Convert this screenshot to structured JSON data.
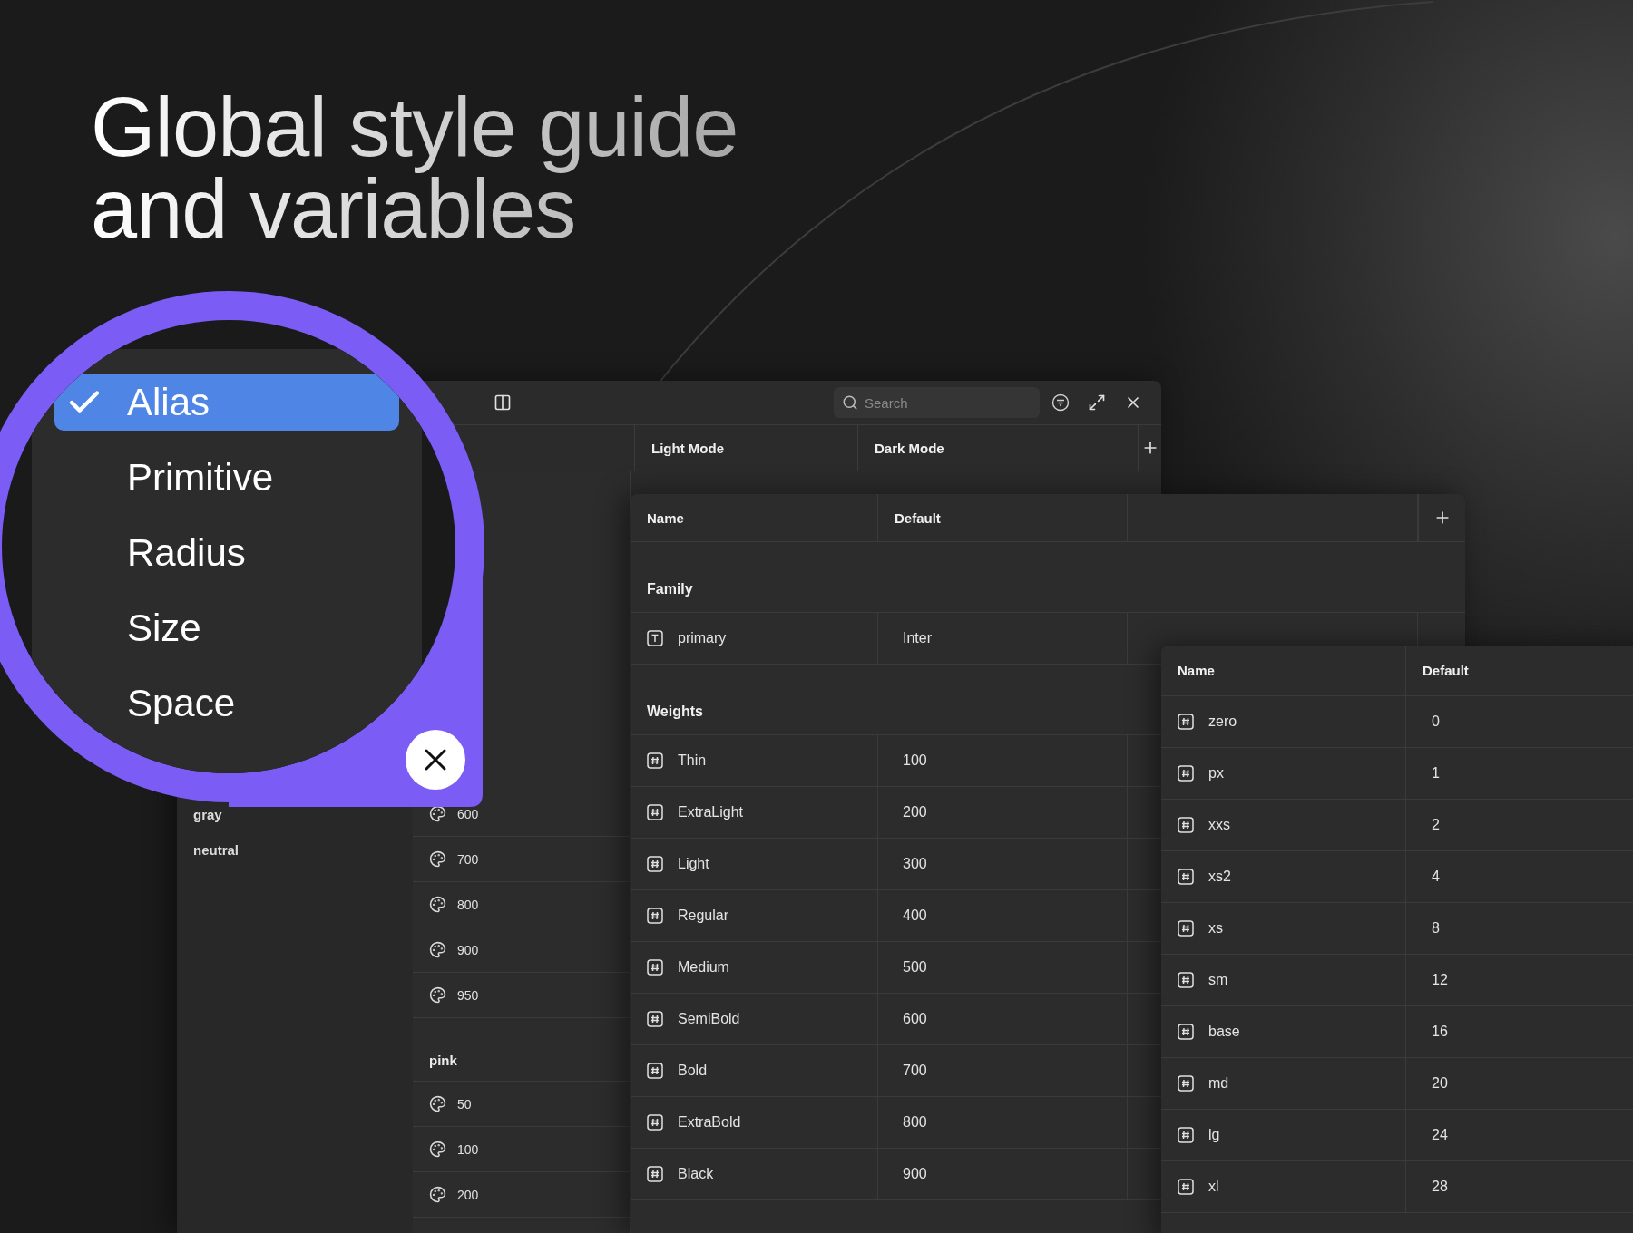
{
  "headline": "Global style guide and variables",
  "type_menu": {
    "items": [
      {
        "label": "Alias",
        "selected": true
      },
      {
        "label": "Primitive",
        "selected": false
      },
      {
        "label": "Radius",
        "selected": false
      },
      {
        "label": "Size",
        "selected": false
      },
      {
        "label": "Space",
        "selected": false
      }
    ]
  },
  "color_window": {
    "search": {
      "placeholder": "Search"
    },
    "modes": [
      "Light Mode",
      "Dark Mode"
    ],
    "groups": [
      "gray",
      "neutral"
    ],
    "swatches": [
      {
        "kind": "swatch",
        "label": "600"
      },
      {
        "kind": "swatch",
        "label": "700"
      },
      {
        "kind": "swatch",
        "label": "800"
      },
      {
        "kind": "swatch",
        "label": "900"
      },
      {
        "kind": "swatch",
        "label": "950"
      },
      {
        "kind": "group",
        "label": "pink"
      },
      {
        "kind": "swatch",
        "label": "50"
      },
      {
        "kind": "swatch",
        "label": "100"
      },
      {
        "kind": "swatch",
        "label": "200"
      }
    ]
  },
  "typography_table": {
    "columns": [
      "Name",
      "Default"
    ],
    "sections": [
      {
        "title": "Family",
        "rows": [
          {
            "kind": "text",
            "name": "primary",
            "value": "Inter"
          }
        ]
      },
      {
        "title": "Weights",
        "rows": [
          {
            "kind": "number",
            "name": "Thin",
            "value": "100"
          },
          {
            "kind": "number",
            "name": "ExtraLight",
            "value": "200"
          },
          {
            "kind": "number",
            "name": "Light",
            "value": "300"
          },
          {
            "kind": "number",
            "name": "Regular",
            "value": "400"
          },
          {
            "kind": "number",
            "name": "Medium",
            "value": "500"
          },
          {
            "kind": "number",
            "name": "SemiBold",
            "value": "600"
          },
          {
            "kind": "number",
            "name": "Bold",
            "value": "700"
          },
          {
            "kind": "number",
            "name": "ExtraBold",
            "value": "800"
          },
          {
            "kind": "number",
            "name": "Black",
            "value": "900"
          }
        ]
      }
    ]
  },
  "spacing_table": {
    "columns": [
      "Name",
      "Default"
    ],
    "rows": [
      {
        "kind": "number",
        "name": "zero",
        "value": "0"
      },
      {
        "kind": "number",
        "name": "px",
        "value": "1"
      },
      {
        "kind": "number",
        "name": "xxs",
        "value": "2"
      },
      {
        "kind": "number",
        "name": "xs2",
        "value": "4"
      },
      {
        "kind": "number",
        "name": "xs",
        "value": "8"
      },
      {
        "kind": "number",
        "name": "sm",
        "value": "12"
      },
      {
        "kind": "number",
        "name": "base",
        "value": "16"
      },
      {
        "kind": "number",
        "name": "md",
        "value": "20"
      },
      {
        "kind": "number",
        "name": "lg",
        "value": "24"
      },
      {
        "kind": "number",
        "name": "xl",
        "value": "28"
      }
    ]
  }
}
